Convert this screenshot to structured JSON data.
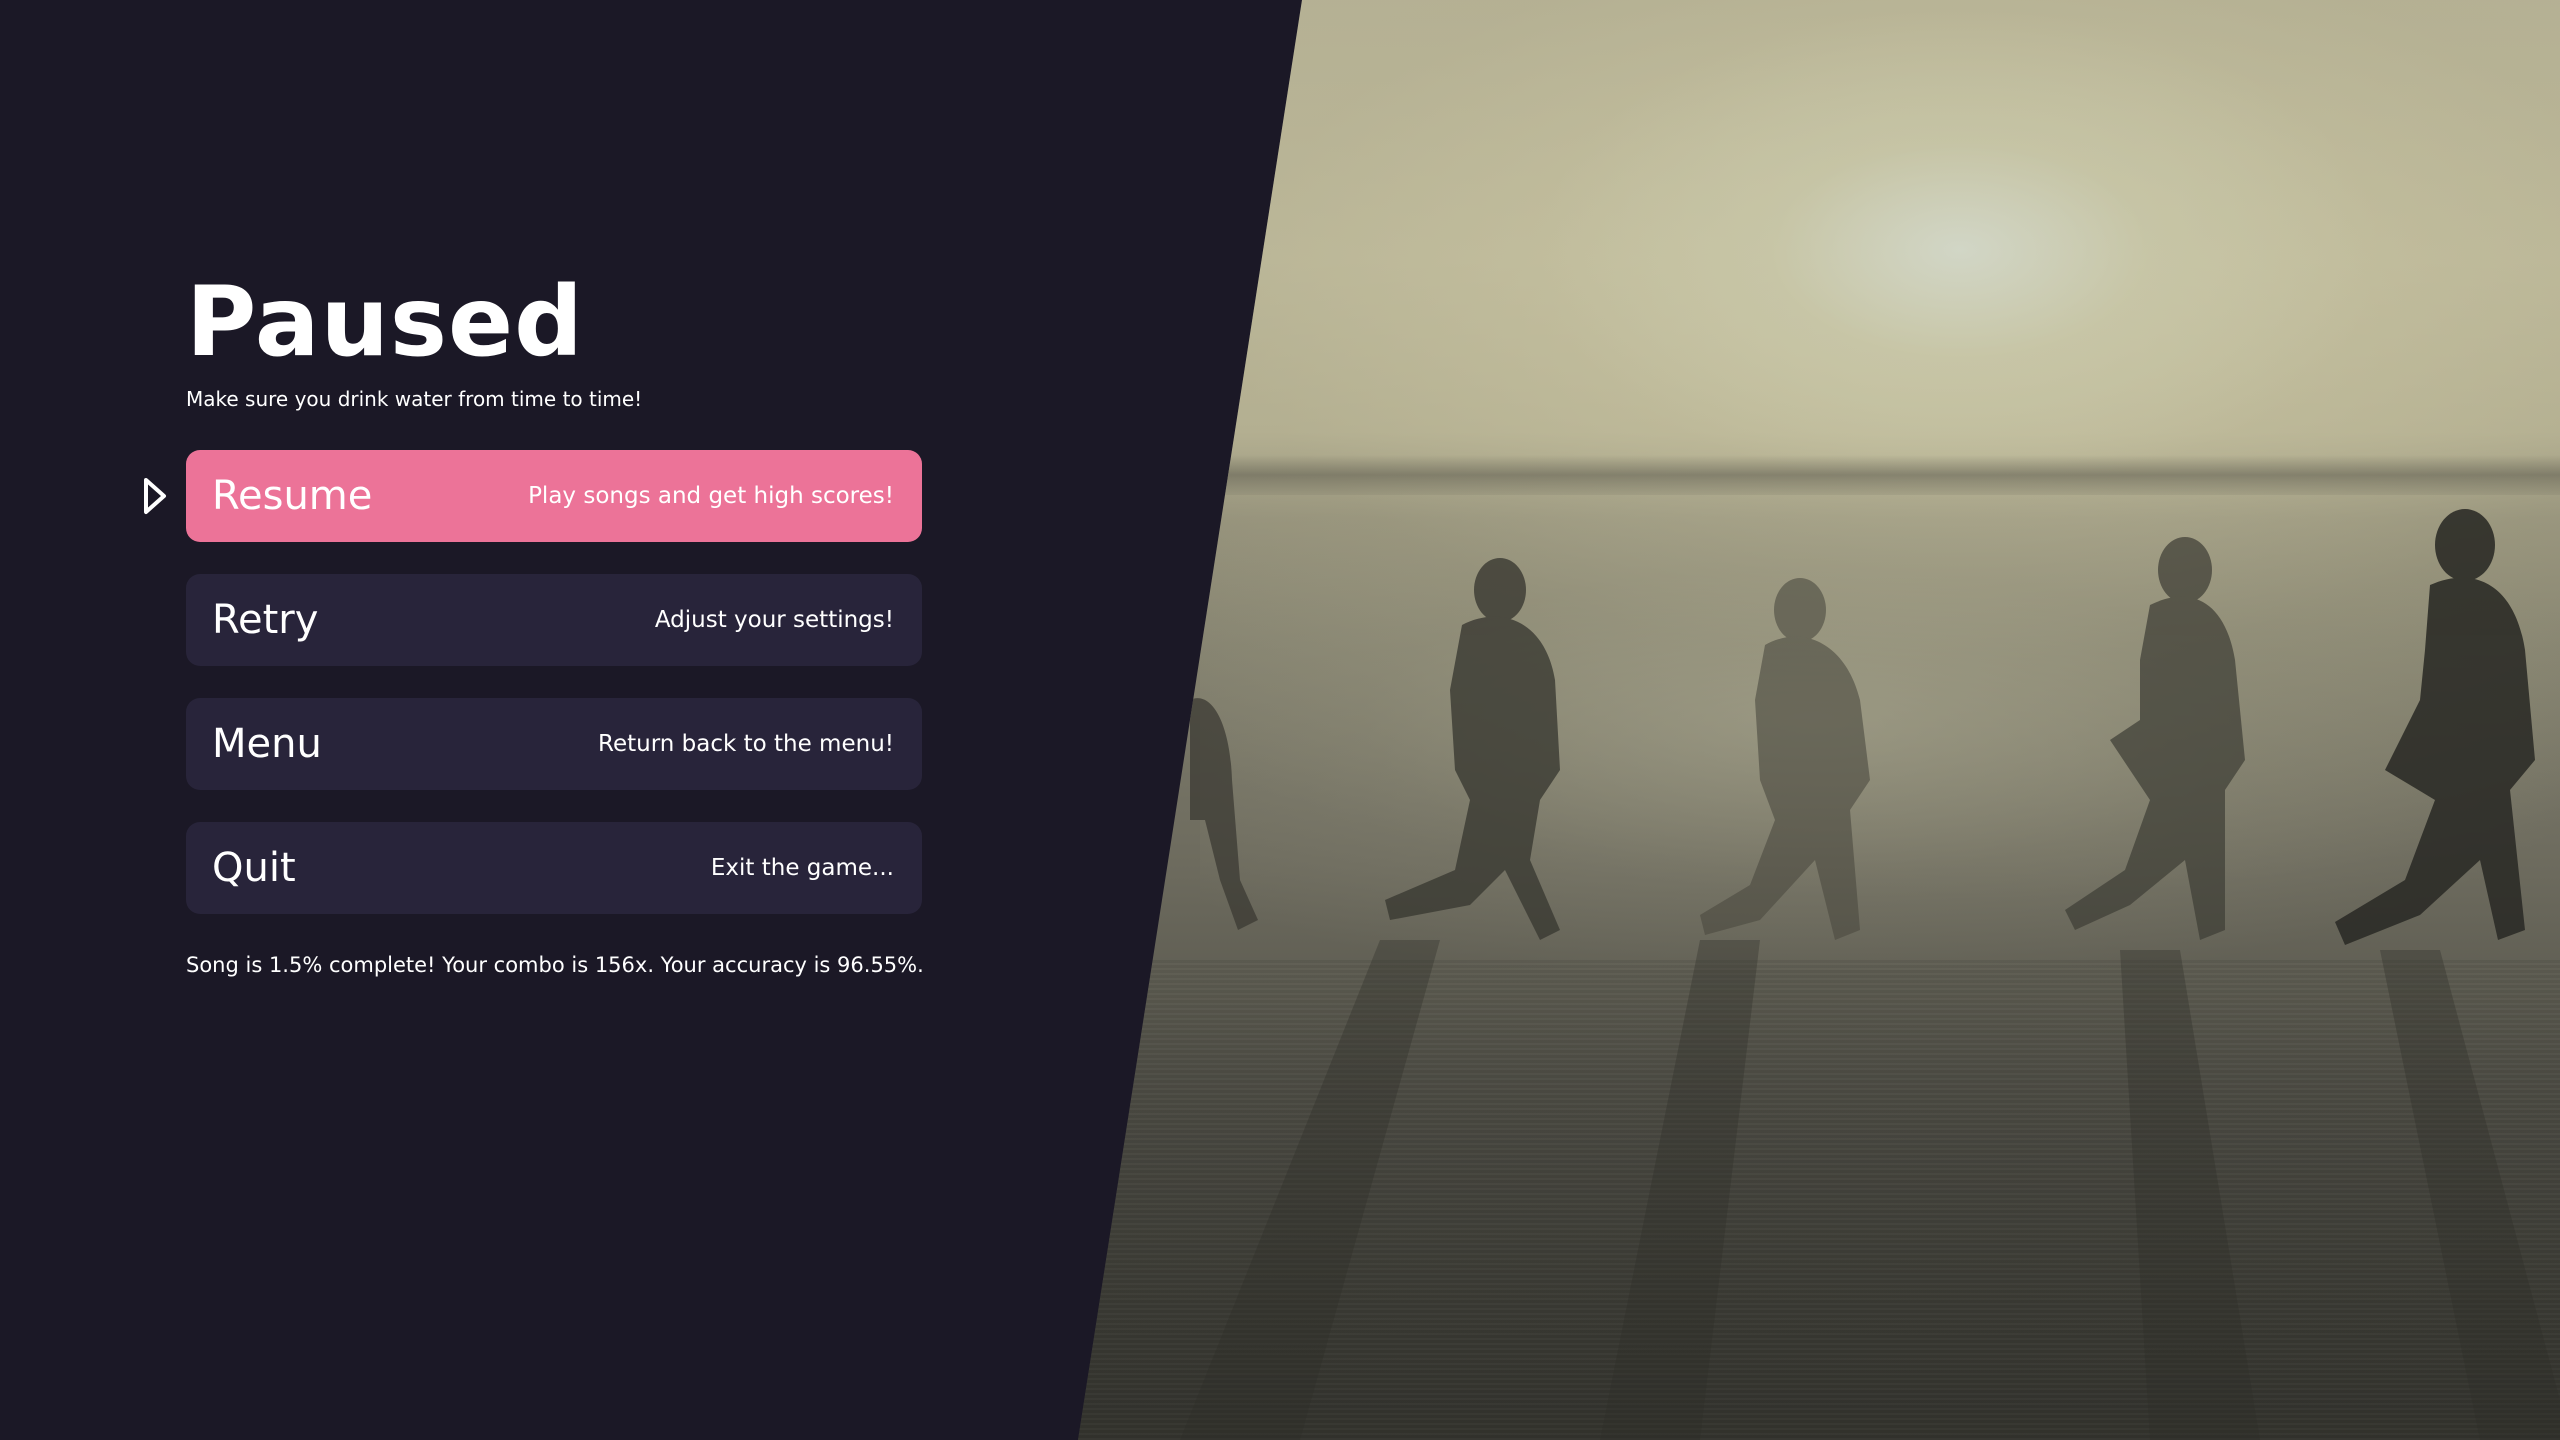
{
  "pause": {
    "title": "Paused",
    "subtitle": "Make sure you drink water from time to time!",
    "stats": "Song is 1.5% complete! Your combo is 156x. Your accuracy is 96.55%."
  },
  "menu": {
    "items": [
      {
        "label": "Resume",
        "description": "Play songs and get high scores!",
        "selected": true
      },
      {
        "label": "Retry",
        "description": "Adjust your settings!",
        "selected": false
      },
      {
        "label": "Menu",
        "description": "Return back to the menu!",
        "selected": false
      },
      {
        "label": "Quit",
        "description": "Exit the game...",
        "selected": false
      }
    ]
  },
  "icons": {
    "pointer": "triangle-pointer-icon"
  },
  "colors": {
    "background": "#1b1826",
    "button": "#28243a",
    "button_selected": "#ec7398",
    "text": "#ffffff"
  }
}
